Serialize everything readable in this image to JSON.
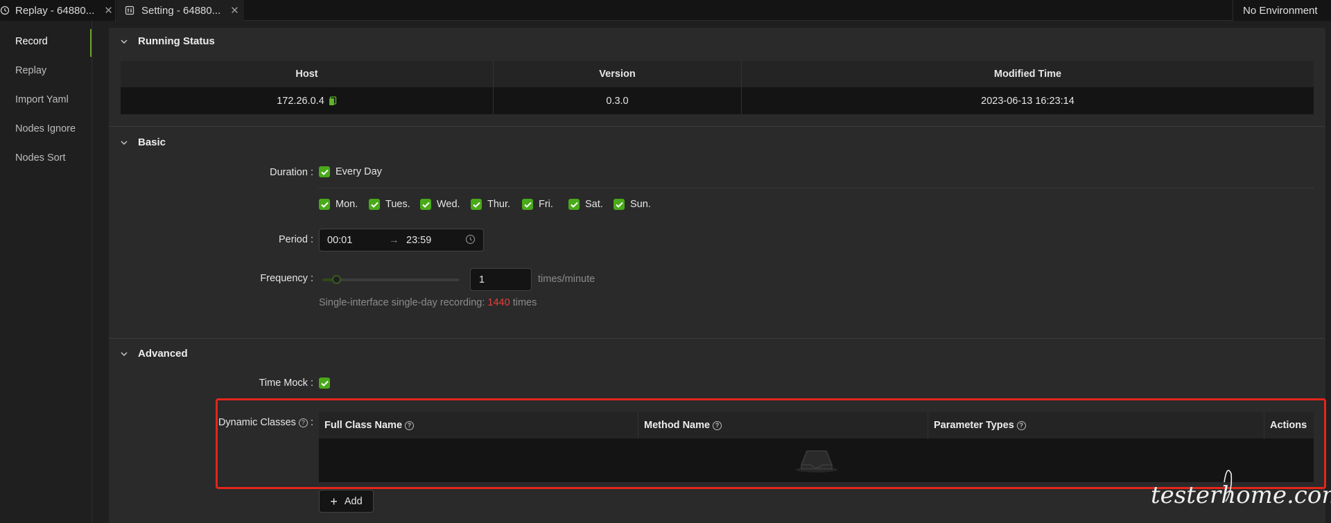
{
  "tabs": [
    {
      "label": "Replay - 64880..."
    },
    {
      "label": "Setting - 64880..."
    }
  ],
  "environment": "No Environment",
  "sidebar": {
    "items": [
      {
        "label": "Record",
        "active": true
      },
      {
        "label": "Replay"
      },
      {
        "label": "Import Yaml"
      },
      {
        "label": "Nodes Ignore"
      },
      {
        "label": "Nodes Sort"
      }
    ]
  },
  "running_status": {
    "title": "Running Status",
    "columns": [
      "Host",
      "Version",
      "Modified Time"
    ],
    "row": {
      "host": "172.26.0.4",
      "version": "0.3.0",
      "modified_time": "2023-06-13 16:23:14"
    }
  },
  "basic": {
    "title": "Basic",
    "duration_label": "Duration",
    "every_day": "Every Day",
    "days": [
      "Mon.",
      "Tues.",
      "Wed.",
      "Thur.",
      "Fri.",
      "Sat.",
      "Sun."
    ],
    "period_label": "Period",
    "period_start": "00:01",
    "period_end": "23:59",
    "frequency_label": "Frequency",
    "frequency_value": "1",
    "frequency_unit": "times/minute",
    "recording_prefix": "Single-interface single-day recording:",
    "recording_count": "1440",
    "recording_suffix": "times"
  },
  "advanced": {
    "title": "Advanced",
    "time_mock_label": "Time Mock",
    "dynamic_classes_label": "Dynamic Classes",
    "columns": [
      "Full Class Name",
      "Method Name",
      "Parameter Types",
      "Actions"
    ],
    "add_label": "Add"
  },
  "watermark": "testerhome.com",
  "colors": {
    "accent": "#49aa19",
    "highlight": "#e3261c",
    "count": "#e8403a"
  }
}
